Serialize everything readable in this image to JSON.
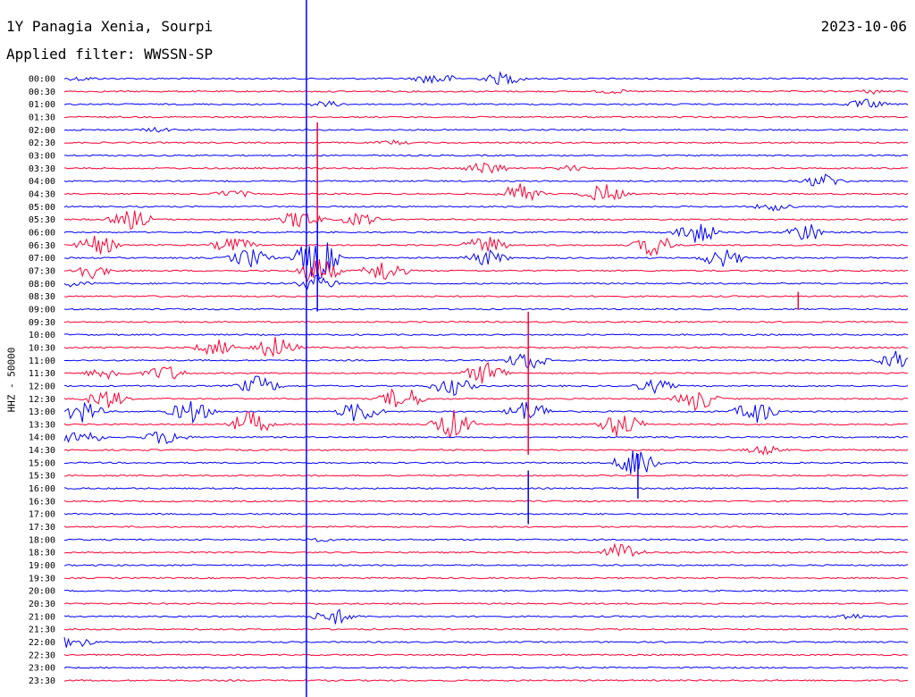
{
  "header": {
    "title": "1Y Panagia Xenia, Sourpi",
    "date": "2023-10-06",
    "filter": "Applied filter: WWSSN-SP"
  },
  "chart_data": {
    "type": "line",
    "subtype": "helicorder",
    "ylabel": "HHZ - 50000",
    "colors": [
      "#0000ff",
      "#ff0033"
    ],
    "row_labels": [
      "00:00",
      "00:30",
      "01:00",
      "01:30",
      "02:00",
      "02:30",
      "03:00",
      "03:30",
      "04:00",
      "04:30",
      "05:00",
      "05:30",
      "06:00",
      "06:30",
      "07:00",
      "07:30",
      "08:00",
      "08:30",
      "09:00",
      "09:30",
      "10:00",
      "10:30",
      "11:00",
      "11:30",
      "12:00",
      "12:30",
      "13:00",
      "13:30",
      "14:00",
      "14:30",
      "15:00",
      "15:30",
      "16:00",
      "16:30",
      "17:00",
      "17:30",
      "18:00",
      "18:30",
      "19:00",
      "19:30",
      "20:00",
      "20:30",
      "21:00",
      "21:30",
      "22:00",
      "22:30",
      "23:00",
      "23:30"
    ],
    "events": [
      {
        "row": 0,
        "t": 0.02,
        "amp": 3
      },
      {
        "row": 0,
        "t": 0.44,
        "amp": 8
      },
      {
        "row": 0,
        "t": 0.52,
        "amp": 8
      },
      {
        "row": 1,
        "t": 0.65,
        "amp": 3
      },
      {
        "row": 1,
        "t": 0.96,
        "amp": 3
      },
      {
        "row": 2,
        "t": 0.31,
        "amp": 4
      },
      {
        "row": 2,
        "t": 0.95,
        "amp": 6
      },
      {
        "row": 4,
        "t": 0.11,
        "amp": 3
      },
      {
        "row": 5,
        "t": 0.39,
        "amp": 3
      },
      {
        "row": 7,
        "t": 0.5,
        "amp": 9
      },
      {
        "row": 7,
        "t": 0.6,
        "amp": 4
      },
      {
        "row": 8,
        "t": 0.9,
        "amp": 9
      },
      {
        "row": 9,
        "t": 0.2,
        "amp": 5
      },
      {
        "row": 9,
        "t": 0.54,
        "amp": 12
      },
      {
        "row": 9,
        "t": 0.64,
        "amp": 12
      },
      {
        "row": 10,
        "t": 0.84,
        "amp": 5
      },
      {
        "row": 11,
        "t": 0.08,
        "amp": 12
      },
      {
        "row": 11,
        "t": 0.28,
        "amp": 12
      },
      {
        "row": 11,
        "t": 0.35,
        "amp": 8
      },
      {
        "row": 12,
        "t": 0.75,
        "amp": 14
      },
      {
        "row": 12,
        "t": 0.88,
        "amp": 12
      },
      {
        "row": 13,
        "t": 0.04,
        "amp": 12
      },
      {
        "row": 13,
        "t": 0.2,
        "amp": 10
      },
      {
        "row": 13,
        "t": 0.5,
        "amp": 12
      },
      {
        "row": 13,
        "t": 0.7,
        "amp": 14
      },
      {
        "row": 14,
        "t": 0.22,
        "amp": 12
      },
      {
        "row": 14,
        "t": 0.3,
        "amp": 28
      },
      {
        "row": 14,
        "t": 0.5,
        "amp": 10
      },
      {
        "row": 14,
        "t": 0.78,
        "amp": 12
      },
      {
        "row": 15,
        "t": 0.03,
        "amp": 10
      },
      {
        "row": 15,
        "t": 0.3,
        "amp": 18
      },
      {
        "row": 15,
        "t": 0.38,
        "amp": 14
      },
      {
        "row": 16,
        "t": 0.01,
        "amp": 4
      },
      {
        "row": 16,
        "t": 0.3,
        "amp": 10
      },
      {
        "row": 21,
        "t": 0.18,
        "amp": 10
      },
      {
        "row": 21,
        "t": 0.25,
        "amp": 14
      },
      {
        "row": 22,
        "t": 0.55,
        "amp": 12
      },
      {
        "row": 22,
        "t": 0.99,
        "amp": 12
      },
      {
        "row": 23,
        "t": 0.05,
        "amp": 8
      },
      {
        "row": 23,
        "t": 0.12,
        "amp": 10
      },
      {
        "row": 23,
        "t": 0.5,
        "amp": 14
      },
      {
        "row": 24,
        "t": 0.23,
        "amp": 12
      },
      {
        "row": 24,
        "t": 0.46,
        "amp": 12
      },
      {
        "row": 24,
        "t": 0.7,
        "amp": 8
      },
      {
        "row": 25,
        "t": 0.05,
        "amp": 12
      },
      {
        "row": 25,
        "t": 0.4,
        "amp": 16
      },
      {
        "row": 25,
        "t": 0.75,
        "amp": 14
      },
      {
        "row": 26,
        "t": 0.02,
        "amp": 14
      },
      {
        "row": 26,
        "t": 0.15,
        "amp": 14
      },
      {
        "row": 26,
        "t": 0.35,
        "amp": 14
      },
      {
        "row": 26,
        "t": 0.55,
        "amp": 14
      },
      {
        "row": 26,
        "t": 0.82,
        "amp": 14
      },
      {
        "row": 27,
        "t": 0.22,
        "amp": 16
      },
      {
        "row": 27,
        "t": 0.46,
        "amp": 18
      },
      {
        "row": 27,
        "t": 0.66,
        "amp": 16
      },
      {
        "row": 28,
        "t": 0.02,
        "amp": 10
      },
      {
        "row": 28,
        "t": 0.12,
        "amp": 10
      },
      {
        "row": 29,
        "t": 0.83,
        "amp": 6
      },
      {
        "row": 30,
        "t": 0.68,
        "amp": 22
      },
      {
        "row": 36,
        "t": 0.3,
        "amp": 3
      },
      {
        "row": 37,
        "t": 0.66,
        "amp": 12
      },
      {
        "row": 42,
        "t": 0.32,
        "amp": 10
      },
      {
        "row": 42,
        "t": 0.93,
        "amp": 4
      },
      {
        "row": 44,
        "t": 0.01,
        "amp": 8
      }
    ],
    "spikes": [
      {
        "row": 9,
        "t": 0.3,
        "up": 80,
        "down": 40
      },
      {
        "row": 14,
        "t": 0.3,
        "up": 40,
        "down": 60
      },
      {
        "row": 21,
        "t": 0.55,
        "up": 40,
        "down": 120
      },
      {
        "row": 32,
        "t": 0.55,
        "up": 20,
        "down": 40
      },
      {
        "row": 17,
        "t": 0.87,
        "up": 5,
        "down": 15
      },
      {
        "row": 30,
        "t": 0.68,
        "up": 10,
        "down": 40
      }
    ],
    "marker_time": 0.287
  }
}
